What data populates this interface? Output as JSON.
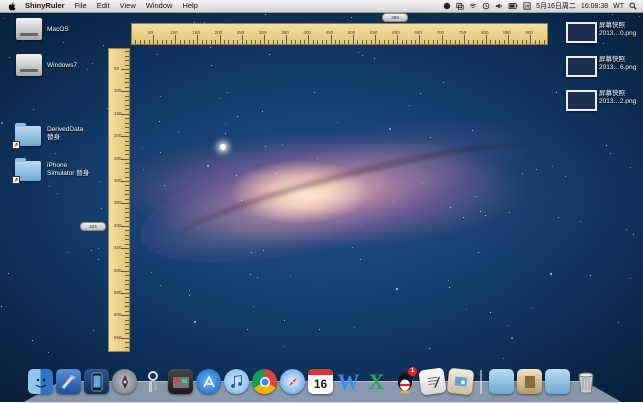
{
  "menubar": {
    "app_name": "ShinyRuler",
    "menus": [
      "File",
      "Edit",
      "View",
      "Window",
      "Help"
    ],
    "status": {
      "date_time": "5月16日周二",
      "clock": "16:08:38",
      "user": "WT"
    }
  },
  "desktop": {
    "drives": [
      {
        "label": "MacOS"
      },
      {
        "label": "Windows7"
      }
    ],
    "folders": [
      {
        "label_line1": "DerivedData",
        "label_line2": "替身"
      },
      {
        "label_line1": "iPhone",
        "label_line2": "Simulator 替身"
      }
    ],
    "screenshots": [
      {
        "line1": "屏幕快照",
        "line2": "2013…0.png"
      },
      {
        "line1": "屏幕快照",
        "line2": "2013…6.png"
      },
      {
        "line1": "屏幕快照",
        "line2": "2013…2.png"
      }
    ]
  },
  "ruler": {
    "horizontal_labels": [
      "50",
      "100",
      "150",
      "200",
      "250",
      "300",
      "350",
      "400",
      "450",
      "500",
      "550",
      "600",
      "650",
      "700",
      "750",
      "800",
      "850",
      "900"
    ],
    "vertical_labels": [
      "50",
      "100",
      "150",
      "200",
      "250",
      "300",
      "350",
      "400",
      "450",
      "500",
      "550",
      "600",
      "650"
    ],
    "horizontal_pill": "399",
    "vertical_pill": "404"
  },
  "dock": {
    "items": [
      "finder",
      "xcode",
      "iphone-simulator",
      "launchpad",
      "keychain",
      "photo-booth",
      "app-store",
      "itunes",
      "chrome",
      "safari",
      "calendar",
      "wps-writer",
      "wps-spreadsheet",
      "qq",
      "textedit",
      "preview"
    ],
    "calendar_date": "16",
    "qq_badge": "1",
    "right_items": [
      "folder",
      "photos",
      "documents",
      "trash"
    ]
  }
}
